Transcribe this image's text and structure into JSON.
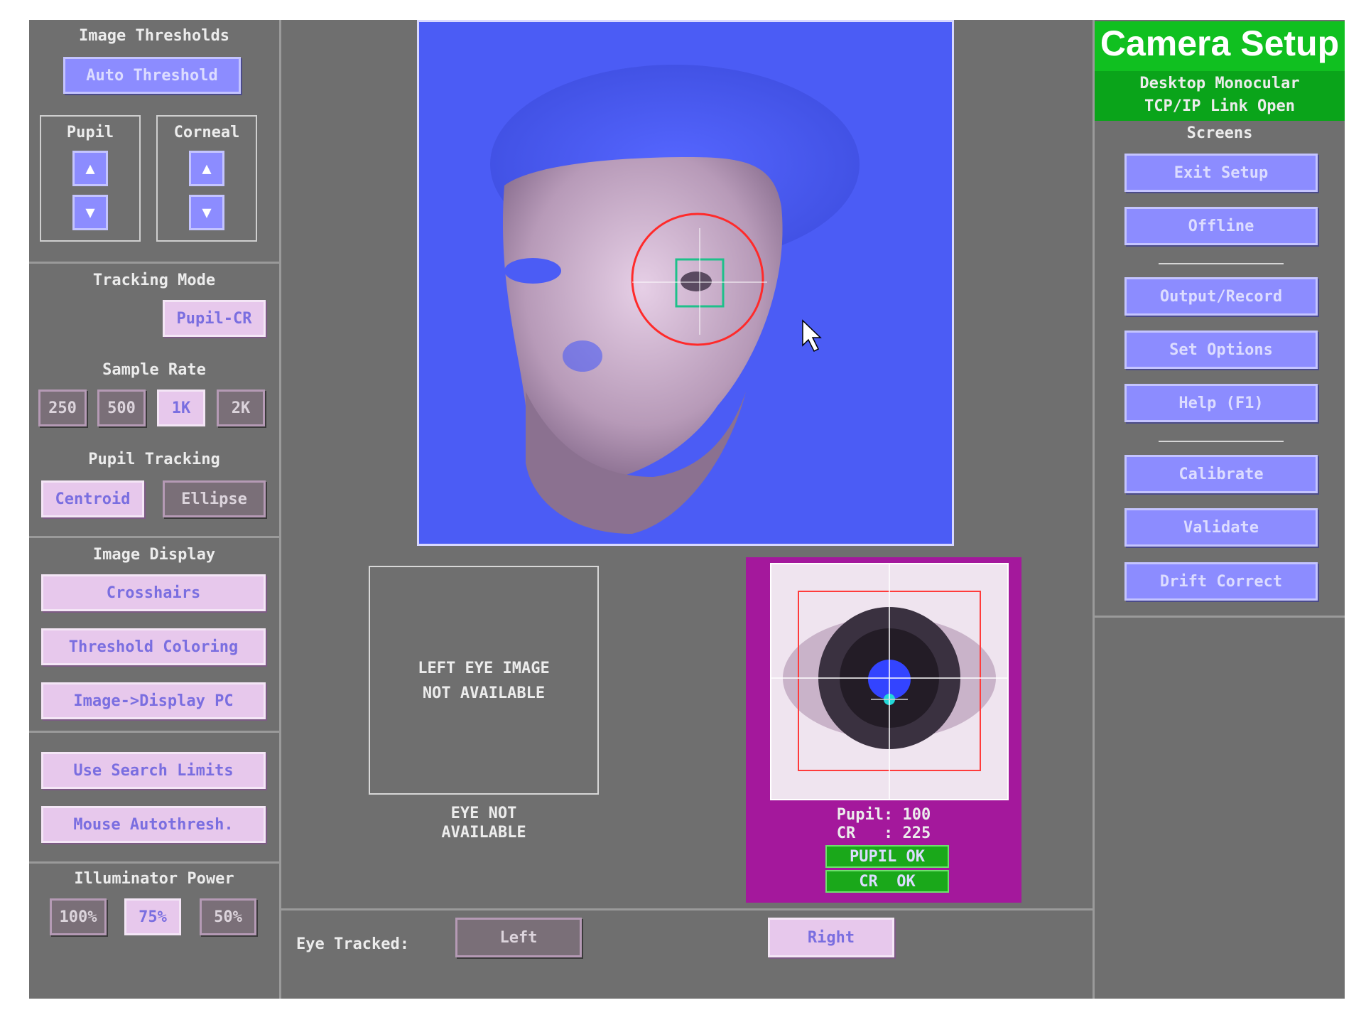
{
  "left_panel": {
    "thresholds_title": "Image Thresholds",
    "auto_threshold": "Auto Threshold",
    "pupil_label": "Pupil",
    "corneal_label": "Corneal",
    "tracking_mode_title": "Tracking Mode",
    "tracking_mode_value": "Pupil-CR",
    "sample_rate_title": "Sample Rate",
    "sample_rates": [
      "250",
      "500",
      "1K",
      "2K"
    ],
    "pupil_tracking_title": "Pupil Tracking",
    "centroid": "Centroid",
    "ellipse": "Ellipse",
    "image_display_title": "Image Display",
    "crosshairs": "Crosshairs",
    "threshold_coloring": "Threshold Coloring",
    "image_display_pc": "Image->Display PC",
    "use_search_limits": "Use Search Limits",
    "mouse_autothresh": "Mouse Autothresh.",
    "illuminator_title": "Illuminator Power",
    "illuminator_levels": [
      "100%",
      "75%",
      "50%"
    ]
  },
  "center": {
    "left_eye_unavailable_line1": "LEFT EYE IMAGE",
    "left_eye_unavailable_line2": "NOT AVAILABLE",
    "eye_not_available_line1": "EYE NOT",
    "eye_not_available_line2": "AVAILABLE",
    "pupil_value_line": "Pupil: 100",
    "cr_value_line": "CR   : 225",
    "pupil_ok": "PUPIL OK",
    "cr_ok": "CR  OK",
    "eye_tracked_label": "Eye Tracked:",
    "left_button": "Left",
    "right_button": "Right"
  },
  "right_panel": {
    "title": "Camera Setup",
    "subtitle_line1": "Desktop Monocular",
    "subtitle_line2": "TCP/IP Link Open",
    "screens_title": "Screens",
    "exit_setup": "Exit Setup",
    "offline": "Offline",
    "output_record": "Output/Record",
    "set_options": "Set Options",
    "help": "Help (F1)",
    "calibrate": "Calibrate",
    "validate": "Validate",
    "drift_correct": "Drift Correct"
  },
  "colors": {
    "background": "#6f6f6f",
    "camera_bg": "#4b5cf5",
    "title_green": "#10c020",
    "eye_panel_magenta": "#a4189c",
    "status_green": "#1aa81a"
  },
  "icons": {
    "up_arrow": "arrow-up-icon",
    "down_arrow": "arrow-down-icon",
    "cursor": "mouse-pointer-icon"
  }
}
